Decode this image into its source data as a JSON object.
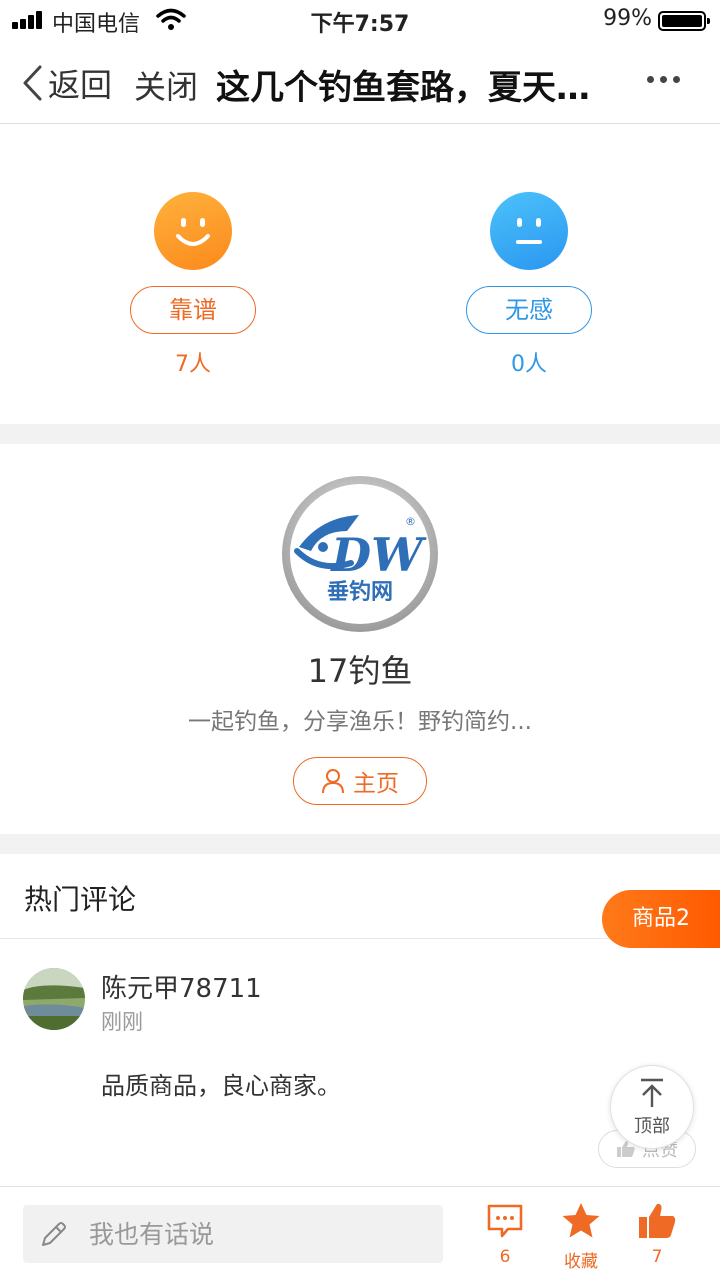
{
  "status_bar": {
    "carrier": "中国电信",
    "time": "下午7:57",
    "battery": "99%"
  },
  "nav": {
    "back_label": "返回",
    "close_label": "关闭",
    "title": "这几个钓鱼套路，夏天…"
  },
  "rating": {
    "reliable_label": "靠谱",
    "reliable_count": "7人",
    "neutral_label": "无感",
    "neutral_count": "0人"
  },
  "author": {
    "name": "17钓鱼",
    "description": "一起钓鱼，分享渔乐！野钓简约...",
    "home_label": "主页",
    "logo_text": "DW",
    "logo_caption": "垂钓网"
  },
  "comments": {
    "title": "热门评论",
    "goods_tab": "商品2",
    "items": [
      {
        "user": "陈元甲78711",
        "time": "刚刚",
        "text": "品质商品，良心商家。",
        "like_label": "点赞"
      }
    ]
  },
  "top_button_label": "顶部",
  "bottom_bar": {
    "input_placeholder": "我也有话说",
    "comment_count": "6",
    "favorite_label": "收藏",
    "like_count": "7"
  },
  "colors": {
    "accent": "#ef6a24",
    "blue": "#2e97e6"
  }
}
